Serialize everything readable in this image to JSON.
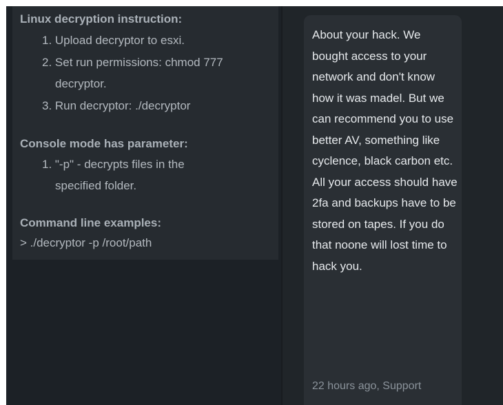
{
  "instructions": {
    "linux_heading": "Linux decryption instruction:",
    "linux_steps": [
      "1. Upload decryptor to esxi.",
      "2. Set run permissions: chmod 777",
      "decryptor.",
      "3. Run decryptor: ./decryptor"
    ],
    "console_heading": "Console mode has parameter:",
    "console_params": [
      "1. \"-p\" - decrypts files in the",
      "specified folder."
    ],
    "examples_heading": "Command line examples:",
    "example_command": "> ./decryptor -p /root/path"
  },
  "message": {
    "text": "About your hack. We bought access to your network and don't know how it was madel. But we can recommend you to use better AV, something like cyclence, black carbon etc. All your access should have 2fa and backups have to be stored on tapes. If you do that noone will lost time to hack you.",
    "meta": "22 hours ago, Support"
  }
}
